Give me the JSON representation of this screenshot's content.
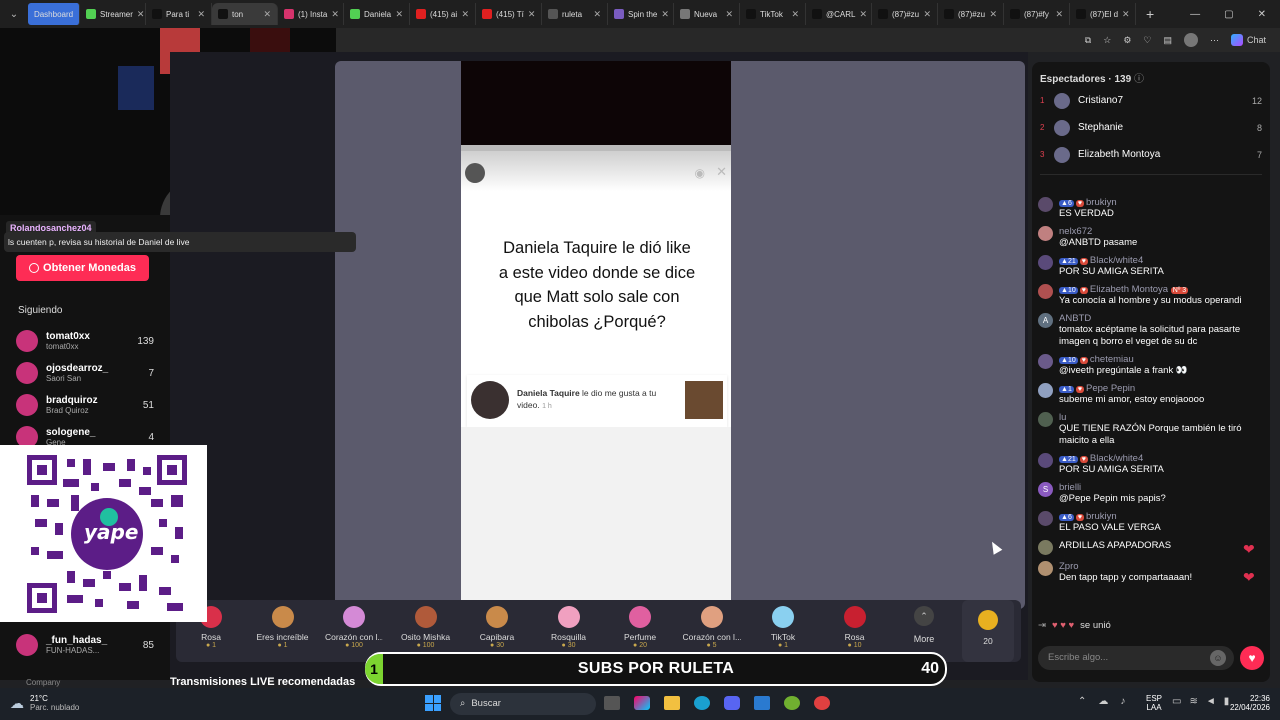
{
  "tabs": [
    {
      "label": "Dashboard",
      "color": "#4a7fe0"
    },
    {
      "label": "Streamer",
      "color": "#52d053"
    },
    {
      "label": "Para ti",
      "color": "#111"
    },
    {
      "label": "ton",
      "color": "#111"
    },
    {
      "label": "(1) Insta",
      "color": "#d6336c"
    },
    {
      "label": "Daniela",
      "color": "#52d053"
    },
    {
      "label": "(415) ai",
      "color": "#e02020"
    },
    {
      "label": "(415) Tí",
      "color": "#e02020"
    },
    {
      "label": "ruleta",
      "color": "#555"
    },
    {
      "label": "Spin the",
      "color": "#7a5cc0"
    },
    {
      "label": "Nueva",
      "color": "#777"
    },
    {
      "label": "TikTok",
      "color": "#111"
    },
    {
      "label": "@CARL",
      "color": "#111"
    },
    {
      "label": "(87)#zu",
      "color": "#111"
    },
    {
      "label": "(87)#zu",
      "color": "#111"
    },
    {
      "label": "(87)#fy",
      "color": "#111"
    },
    {
      "label": "(87)El d",
      "color": "#111"
    }
  ],
  "browser": {
    "chat_label": "Chat"
  },
  "overlay_user": {
    "name": "Rolandosanchez04",
    "comment": "ls cuenten p, revisa su historial de Daniel de live"
  },
  "left": {
    "coins_button": "Obtener Monedas",
    "following_title": "Siguiendo",
    "following": [
      {
        "name": "tomat0xx",
        "sub": "tomat0xx",
        "count": "139"
      },
      {
        "name": "ojosdearroz_",
        "sub": "Saori San",
        "count": "7"
      },
      {
        "name": "bradquiroz",
        "sub": "Brad Quiroz",
        "count": "51"
      },
      {
        "name": "sologene_",
        "sub": "Gene",
        "count": "4"
      }
    ],
    "extra_follow": {
      "name": "_fun_hadas_",
      "sub": "FUN-HADAS...",
      "count": "85"
    },
    "company": "Company",
    "recommended": "Transmisiones LIVE recomendadas"
  },
  "qr": {
    "brand": "yape"
  },
  "post": {
    "text": "Daniela Taquire le dió like a este video donde se dice que Matt solo sale con chibolas ¿Porqué?",
    "notif_name": "Daniela Taquire",
    "notif_action": "le dio me gusta a tu video.",
    "notif_time": "1 h"
  },
  "gifts": [
    {
      "name": "Rosa",
      "price": "1",
      "color": "#d9304a"
    },
    {
      "name": "Eres increíble",
      "price": "1",
      "color": "#c98a4a"
    },
    {
      "name": "Corazón con l...",
      "price": "100",
      "color": "#d48ad6"
    },
    {
      "name": "Osito Mishka",
      "price": "100",
      "color": "#b05a3a"
    },
    {
      "name": "Capibara",
      "price": "30",
      "color": "#c98a4a"
    },
    {
      "name": "Rosquilla",
      "price": "30",
      "color": "#f0a0c0"
    },
    {
      "name": "Perfume",
      "price": "20",
      "color": "#e060a0"
    },
    {
      "name": "Corazón con l...",
      "price": "5",
      "color": "#e0a080"
    },
    {
      "name": "TikTok",
      "price": "1",
      "color": "#8ad0f0"
    },
    {
      "name": "Rosa",
      "price": "10",
      "color": "#c82030"
    }
  ],
  "gift_more": "More",
  "coin_balance": "20",
  "subs_bar": {
    "title": "SUBS POR RULETA",
    "left": "1",
    "right": "40"
  },
  "chat": {
    "viewers_label": "Espectadores · 139",
    "top": [
      {
        "rank": "1",
        "name": "Cristiano7",
        "score": "12"
      },
      {
        "rank": "2",
        "name": "Stephanie",
        "score": "8"
      },
      {
        "rank": "3",
        "name": "Elizabeth Montoya",
        "score": "7"
      }
    ],
    "messages": [
      {
        "lvl": "6",
        "name": "brukiyn",
        "text": "ES VERDAD",
        "color": "#5a4a6a"
      },
      {
        "lvl": "",
        "name": "nelx672",
        "text": "@ANBTD pasame",
        "color": "#c08080"
      },
      {
        "lvl": "21",
        "name": "Black/white4",
        "text": "POR SU AMIGA SERITA",
        "color": "#5a4a7a"
      },
      {
        "lvl": "10",
        "name": "Elizabeth Montoya",
        "text": "Ya conocía al hombre y su modus operandi",
        "color": "#b05050",
        "tag": "Nº 3"
      },
      {
        "lvl": "",
        "name": "ANBTD",
        "text": "tomatox acéptame la solicitud para pasarte imagen q borro el veget de su dc",
        "color": "#607080",
        "initial": "A"
      },
      {
        "lvl": "10",
        "name": "chetemiau",
        "text": "@iveeth pregúntale a frank 👀",
        "color": "#6a5a8a"
      },
      {
        "lvl": "1",
        "name": "Pepe Pepin",
        "text": "subeme mi amor, estoy enojaoooo",
        "color": "#90a0c0"
      },
      {
        "lvl": "",
        "name": "lu",
        "text": "QUE TIENE RAZÓN Porque también le tiró maicito a ella",
        "color": "#506050"
      },
      {
        "lvl": "21",
        "name": "Black/white4",
        "text": "POR SU AMIGA SERITA",
        "color": "#5a4a7a"
      },
      {
        "lvl": "",
        "name": "brielli",
        "text": "@Pepe Pepin mis papis?",
        "color": "#8a5ac0",
        "initial": "S"
      },
      {
        "lvl": "6",
        "name": "brukiyn",
        "text": "EL PASO VALE VERGA",
        "color": "#5a4a6a"
      },
      {
        "lvl": "",
        "name": "",
        "text": "ARDILLAS APAPADORAS",
        "color": "#7a7a60"
      },
      {
        "lvl": "",
        "name": "Zpro",
        "text": "Den tapp tapp y compartaaaan!",
        "color": "#b09070"
      }
    ],
    "join_text": "se unió",
    "input_placeholder": "Escribe algo..."
  },
  "taskbar": {
    "weather_temp": "21°C",
    "weather_desc": "Parc. nublado",
    "search": "Buscar",
    "lang": "ESP",
    "lang2": "LAA",
    "time": "22:36",
    "date": "22/04/2026"
  }
}
